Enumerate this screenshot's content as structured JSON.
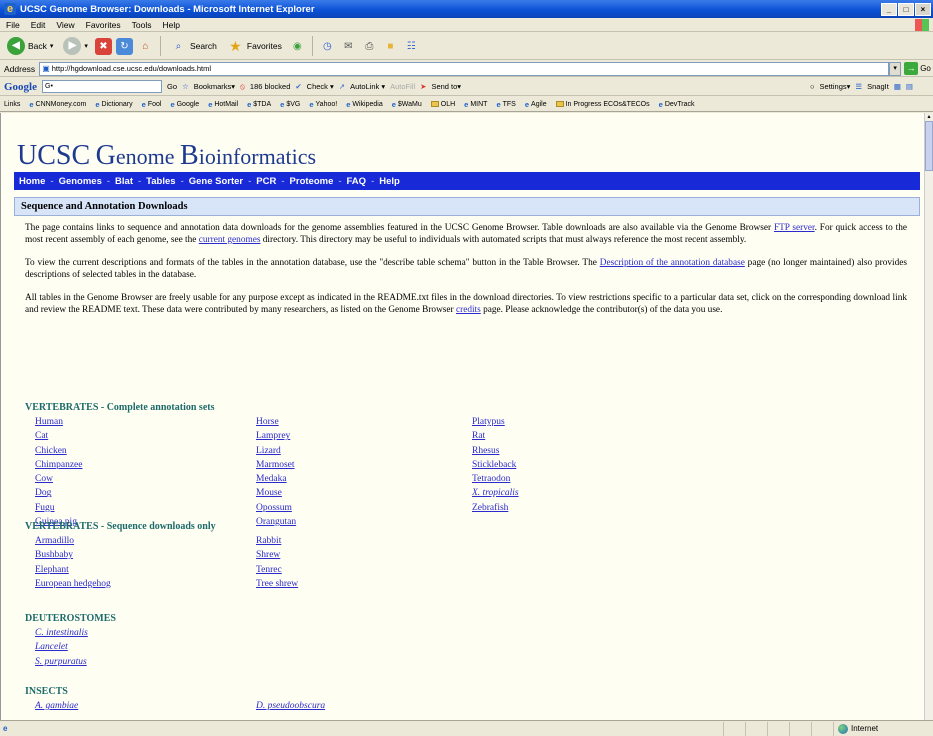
{
  "window": {
    "title": "UCSC Genome Browser: Downloads - Microsoft Internet Explorer",
    "buttons": [
      "_",
      "□",
      "×"
    ]
  },
  "menubar": [
    "File",
    "Edit",
    "View",
    "Favorites",
    "Tools",
    "Help"
  ],
  "toolbar": {
    "back": "Back",
    "search": "Search",
    "favorites": "Favorites"
  },
  "address": {
    "label": "Address",
    "url": "http://hgdownload.cse.ucsc.edu/downloads.html",
    "go": "Go"
  },
  "googlebar": {
    "logo": "Google",
    "search_value": "G•",
    "go": "Go",
    "bookmarks": "Bookmarks▾",
    "blocked": "186 blocked",
    "check": "Check ▾",
    "autolink": "AutoLink ▾",
    "autofill": "AutoFill",
    "sendto": "Send to▾",
    "settings": "Settings▾",
    "snagit": "SnagIt"
  },
  "links": {
    "label": "Links",
    "items": [
      {
        "text": "CNNMoney.com",
        "type": "ie"
      },
      {
        "text": "Dictionary",
        "type": "ie"
      },
      {
        "text": "Fool",
        "type": "ie"
      },
      {
        "text": "Google",
        "type": "ie"
      },
      {
        "text": "HotMail",
        "type": "ie"
      },
      {
        "text": "$TDA",
        "type": "ie"
      },
      {
        "text": "$VG",
        "type": "ie"
      },
      {
        "text": "Yahoo!",
        "type": "ie"
      },
      {
        "text": "Wikipedia",
        "type": "ie"
      },
      {
        "text": "$WaMu",
        "type": "ie"
      },
      {
        "text": "OLH",
        "type": "folder"
      },
      {
        "text": "MINT",
        "type": "ie"
      },
      {
        "text": "TFS",
        "type": "ie"
      },
      {
        "text": "Agile",
        "type": "ie"
      },
      {
        "text": "In Progress ECOs&TECOs",
        "type": "folder"
      },
      {
        "text": "DevTrack",
        "type": "ie"
      }
    ]
  },
  "page": {
    "logo_text": {
      "u": "UCSC",
      "g": "G",
      "enome": "enome ",
      "b": "B",
      "ioinformatics": "ioinformatics"
    },
    "nav": [
      "Home",
      "Genomes",
      "Blat",
      "Tables",
      "Gene Sorter",
      "PCR",
      "Proteome",
      "FAQ",
      "Help"
    ],
    "section_title": "Sequence and Annotation Downloads",
    "p1_a": "The page contains links to sequence and annotation data downloads for the genome assemblies featured in the UCSC Genome Browser. Table downloads are also available via the Genome Browser ",
    "p1_link1": "FTP server",
    "p1_b": ". For quick access to the most recent assembly of each genome, see the ",
    "p1_link2": "current genomes",
    "p1_c": " directory. This directory may be useful to individuals with automated scripts that must always reference the most recent assembly.",
    "p2_a": "To view the current descriptions and formats of the tables in the annotation database, use the \"describe table schema\" button in the Table Browser. The ",
    "p2_link": "Description of the annotation database",
    "p2_b": " page (no longer maintained) also provides descriptions of selected tables in the database.",
    "p3_a": "All tables in the Genome Browser are freely usable for any purpose except as indicated in the README.txt files in the download directories. To view restrictions specific to a particular data set, click on the corresponding download link and review the README text. These data were contributed by many researchers, as listed on the Genome Browser ",
    "p3_link": "credits",
    "p3_b": " page. Please acknowledge the contributor(s) of the data you use.",
    "vert_complete_title": "VERTEBRATES - Complete annotation sets",
    "vert_complete_col1": [
      "Human",
      "Cat",
      "Chicken",
      "Chimpanzee",
      "Cow",
      "Dog",
      "Fugu",
      "Guinea pig"
    ],
    "vert_complete_col2": [
      "Horse",
      "Lamprey",
      "Lizard",
      "Marmoset",
      "Medaka",
      "Mouse",
      "Opossum",
      "Orangutan"
    ],
    "vert_complete_col3": [
      "Platypus",
      "Rat",
      "Rhesus",
      "Stickleback",
      "Tetraodon",
      "X. tropicalis",
      "Zebrafish"
    ],
    "vert_seq_title": "VERTEBRATES - Sequence downloads only",
    "vert_seq_col1": [
      "Armadillo",
      "Bushbaby",
      "Elephant",
      "European hedgehog"
    ],
    "vert_seq_col2": [
      "Rabbit",
      "Shrew",
      "Tenrec",
      "Tree shrew"
    ],
    "deut_title": "DEUTEROSTOMES",
    "deut_col1": [
      "C. intestinalis",
      "Lancelet",
      "S. purpuratus"
    ],
    "insects_title": "INSECTS",
    "insects_col1": [
      "A. gambiae"
    ],
    "insects_col2": [
      "D. pseudoobscura"
    ]
  },
  "status": {
    "zone": "Internet"
  }
}
